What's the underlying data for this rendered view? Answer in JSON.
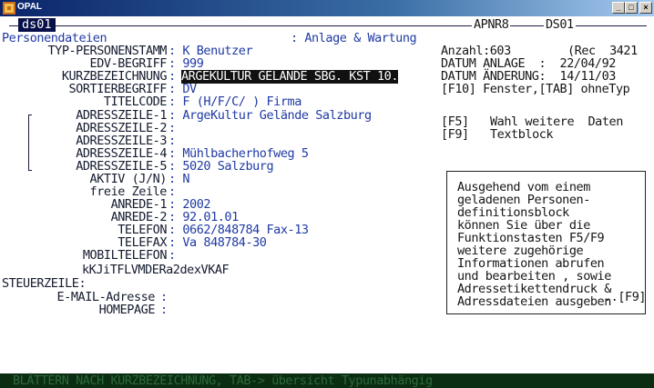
{
  "window": {
    "title": "OPAL"
  },
  "header": {
    "left_tag": "ds01",
    "apnr": "APNR8",
    "ds": "DS01"
  },
  "section": {
    "name": "Personendateien",
    "mode": ": Anlage & Wartung"
  },
  "fields": [
    {
      "label": "TYP-PERSONENSTAMM",
      "value": ": K Benutzer"
    },
    {
      "label": "EDV-BEGRIFF",
      "value": ": 999"
    },
    {
      "label": "KURZBEZEICHNUNG",
      "value": "ARGEKULTUR GELÄNDE SBG. KST 10."
    },
    {
      "label": "SORTIERBEGRIFF",
      "value": ": DV"
    },
    {
      "label": "TITELCODE",
      "value": ": F (H/F/C/ ) Firma"
    },
    {
      "label": "ADRESSZEILE-1",
      "value": ": ArgeKultur Gelände Salzburg"
    },
    {
      "label": "ADRESSZEILE-2",
      "value": ":"
    },
    {
      "label": "ADRESSZEILE-3",
      "value": ":"
    },
    {
      "label": "ADRESSZEILE-4",
      "value": ": Mühlbacherhofweg 5"
    },
    {
      "label": "ADRESSZEILE-5",
      "value": ": 5020 Salzburg"
    },
    {
      "label": "AKTIV (J/N)",
      "value": ": N"
    },
    {
      "label": "freie Zeile",
      "value": ":"
    },
    {
      "label": "ANREDE-1",
      "value": ": 2002"
    },
    {
      "label": "ANREDE-2",
      "value": ": 92.01.01"
    },
    {
      "label": "TELEFON",
      "value": ": 0662/848784 Fax-13"
    },
    {
      "label": "TELEFAX",
      "value": ": Va 848784-30"
    },
    {
      "label": "MOBILTELEFON",
      "value": ":"
    }
  ],
  "code_line": "kKJiTFLVMDERa2dexVKAF",
  "steuer_label": "STEUERZEILE:",
  "email": {
    "label": "E-MAIL-Adresse",
    "value": ":"
  },
  "homepage": {
    "label": "HOMEPAGE",
    "value": ":"
  },
  "right_info": {
    "anzahl": "Anzahl:603",
    "rec": "(Rec  3421",
    "datum_anlage": "DATUM ANLAGE  :  22/04/92",
    "datum_aenderung": "DATUM ÄNDERUNG:  14/11/03",
    "f10": "[F10] Fenster,[TAB] ohneTyp",
    "f5_key": "[F5]",
    "f5_text": "Wahl weitere  Daten",
    "f9_key": "[F9]",
    "f9_text": "Textblock"
  },
  "info_box_lines": [
    "Ausgehend vom einem",
    "geladenen Personen-",
    "definitionsblock",
    "können Sie über die",
    "Funktionstasten F5/F9",
    "weitere zugehörige",
    "Informationen abrufen",
    "und bearbeiten , sowie",
    "Adressetikettendruck &",
    "Adressdateien ausgeben"
  ],
  "f9_hint": "..[F9]",
  "status_bar": "BLÄTTERN NACH KURZBEZEICHNUNG, TAB-> übersicht Typunabhängig",
  "icons": {
    "app": "opal-app-icon",
    "minimize": "minimize-icon",
    "maximize": "maximize-icon",
    "close": "close-icon"
  },
  "colors": {
    "title_gradient_start": "#0a246a",
    "text_blue": "#1f3aa3",
    "status_bg": "#0b2d12",
    "status_text": "#2c6a3a"
  }
}
